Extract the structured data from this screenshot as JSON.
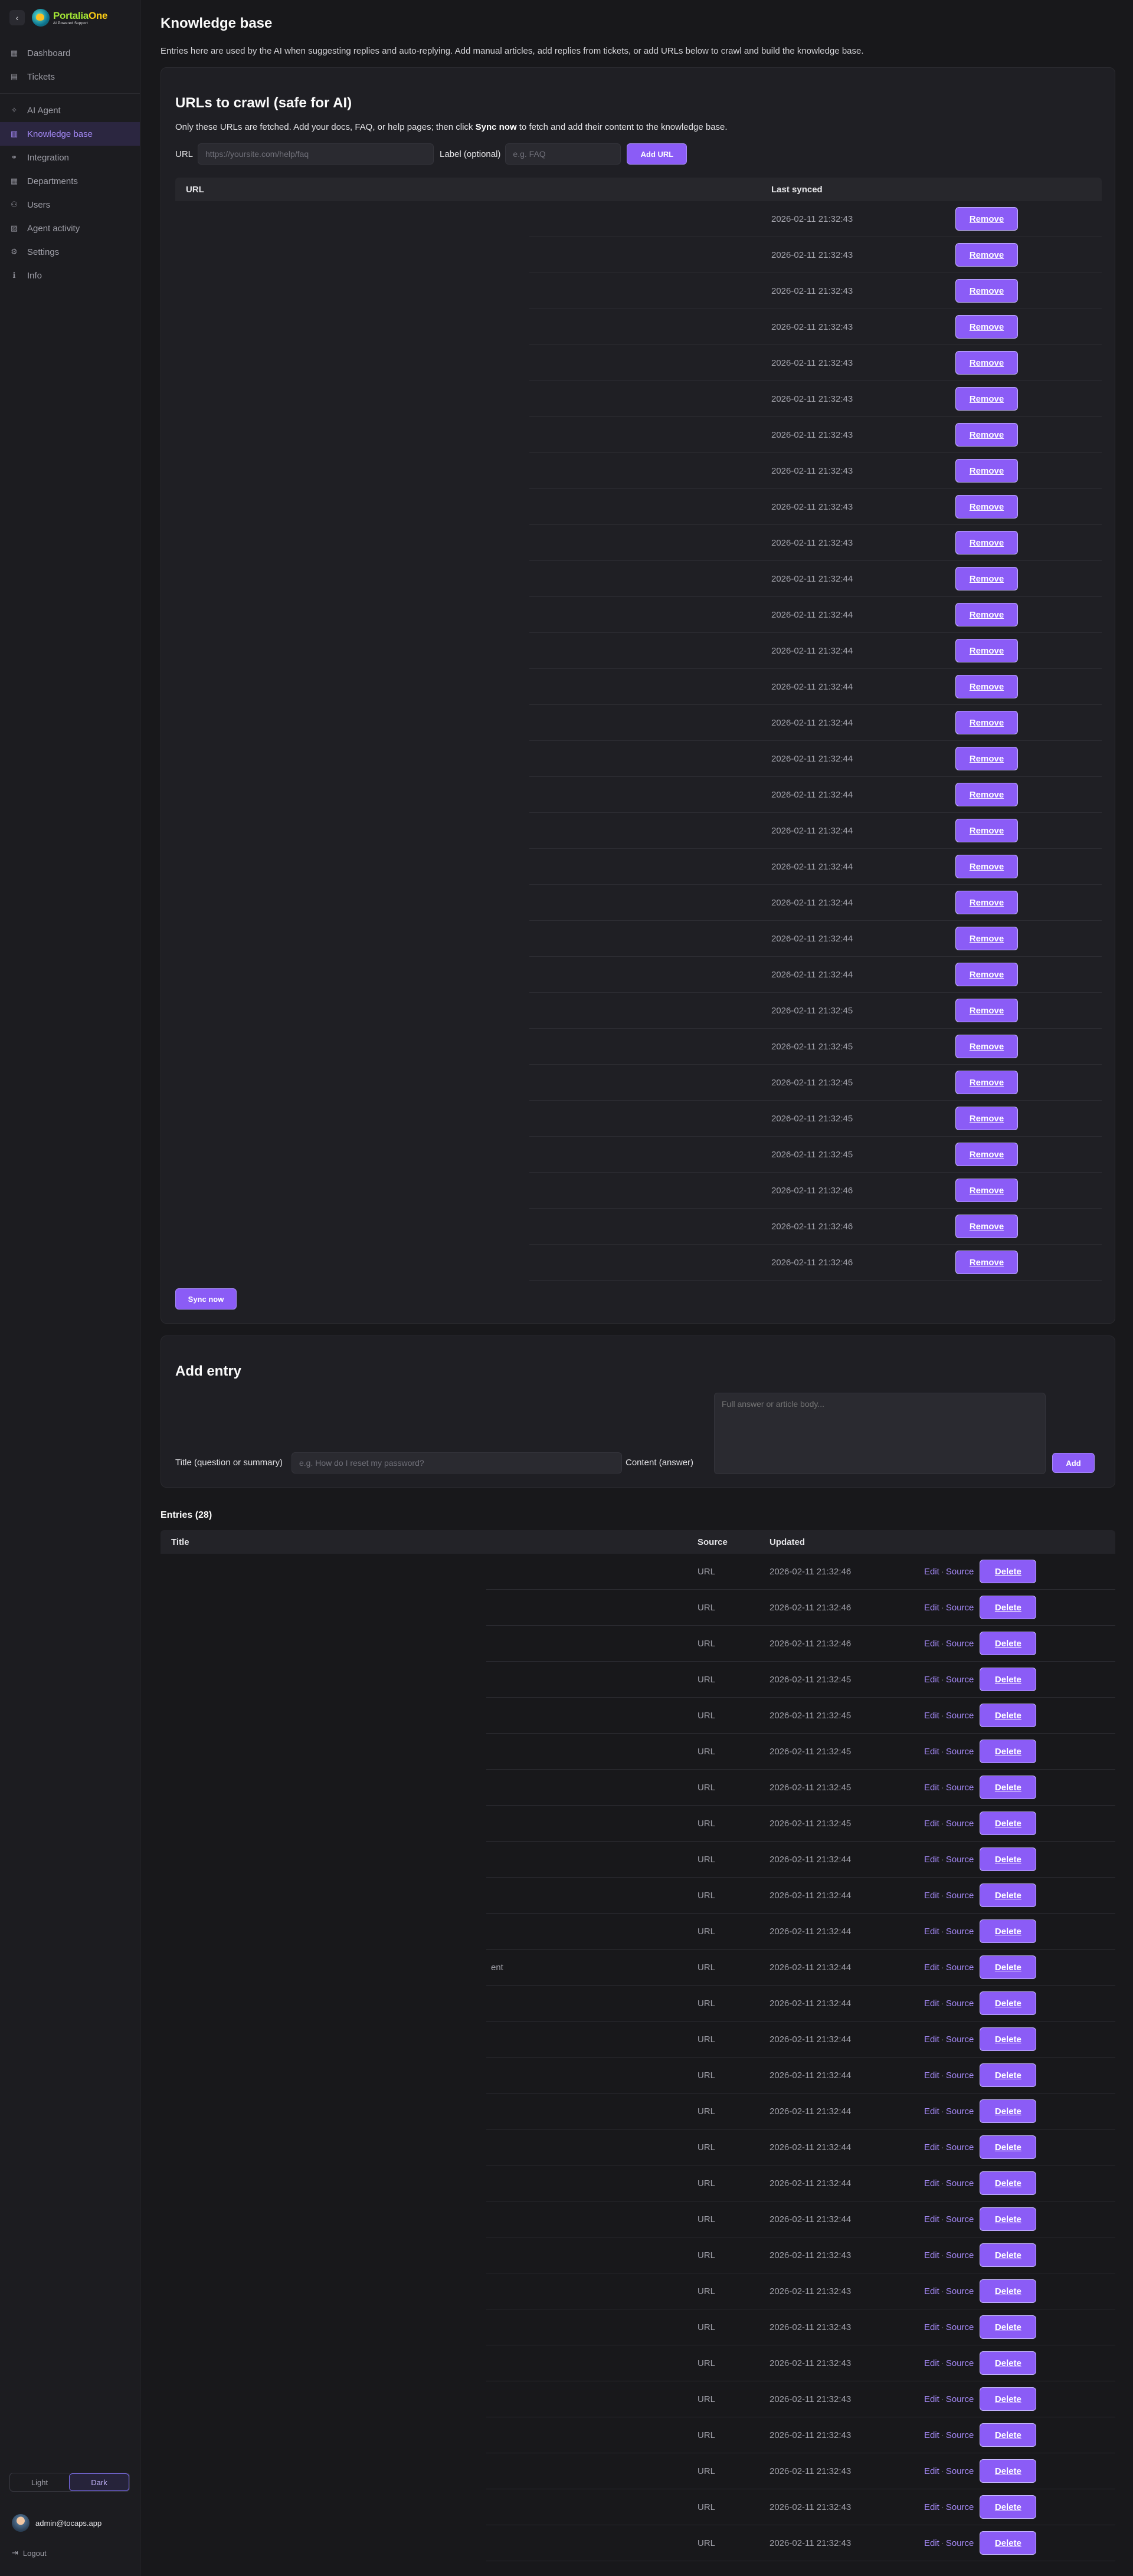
{
  "brand": {
    "name_a": "Portalia",
    "name_b": "One",
    "tagline": "AI Powered Support"
  },
  "sidebar": {
    "items": [
      {
        "label": "Dashboard",
        "icon": "grid-icon"
      },
      {
        "label": "Tickets",
        "icon": "ticket-icon"
      },
      {
        "label": "AI Agent",
        "icon": "sparkle-icon"
      },
      {
        "label": "Knowledge base",
        "icon": "book-icon",
        "active": true
      },
      {
        "label": "Integration",
        "icon": "link-icon"
      },
      {
        "label": "Departments",
        "icon": "building-icon"
      },
      {
        "label": "Users",
        "icon": "users-icon"
      },
      {
        "label": "Agent activity",
        "icon": "chart-icon"
      },
      {
        "label": "Settings",
        "icon": "gear-icon"
      },
      {
        "label": "Info",
        "icon": "info-icon"
      }
    ],
    "theme": {
      "light": "Light",
      "dark": "Dark",
      "selected": "dark"
    },
    "user_email": "admin@tocaps.app",
    "logout_label": "Logout"
  },
  "page": {
    "title": "Knowledge base",
    "description": "Entries here are used by the AI when suggesting replies and auto-replying. Add manual articles, add replies from tickets, or add URLs below to crawl and build the knowledge base."
  },
  "crawl": {
    "title": "URLs to crawl (safe for AI)",
    "hint_pre": "Only these URLs are fetched. Add your docs, FAQ, or help pages; then click ",
    "hint_bold": "Sync now",
    "hint_post": " to fetch and add their content to the knowledge base.",
    "url_label": "URL",
    "url_placeholder": "https://yoursite.com/help/faq",
    "label_label": "Label (optional)",
    "label_placeholder": "e.g. FAQ",
    "add_button": "Add URL",
    "col_url": "URL",
    "col_last_synced": "Last synced",
    "remove_label": "Remove",
    "sync_button": "Sync now",
    "rows": [
      {
        "url": "",
        "synced": "2026-02-11 21:32:43"
      },
      {
        "url": "",
        "synced": "2026-02-11 21:32:43"
      },
      {
        "url": "",
        "synced": "2026-02-11 21:32:43"
      },
      {
        "url": "",
        "synced": "2026-02-11 21:32:43"
      },
      {
        "url": "",
        "synced": "2026-02-11 21:32:43"
      },
      {
        "url": "",
        "synced": "2026-02-11 21:32:43"
      },
      {
        "url": "",
        "synced": "2026-02-11 21:32:43"
      },
      {
        "url": "",
        "synced": "2026-02-11 21:32:43"
      },
      {
        "url": "",
        "synced": "2026-02-11 21:32:43"
      },
      {
        "url": "",
        "synced": "2026-02-11 21:32:43"
      },
      {
        "url": "",
        "synced": "2026-02-11 21:32:44"
      },
      {
        "url": "",
        "synced": "2026-02-11 21:32:44"
      },
      {
        "url": "",
        "synced": "2026-02-11 21:32:44"
      },
      {
        "url": "",
        "synced": "2026-02-11 21:32:44"
      },
      {
        "url": "",
        "synced": "2026-02-11 21:32:44"
      },
      {
        "url": "",
        "synced": "2026-02-11 21:32:44"
      },
      {
        "url": "",
        "synced": "2026-02-11 21:32:44"
      },
      {
        "url": "",
        "synced": "2026-02-11 21:32:44"
      },
      {
        "url": "",
        "synced": "2026-02-11 21:32:44"
      },
      {
        "url": "",
        "synced": "2026-02-11 21:32:44"
      },
      {
        "url": "",
        "synced": "2026-02-11 21:32:44"
      },
      {
        "url": "",
        "synced": "2026-02-11 21:32:44"
      },
      {
        "url": "",
        "synced": "2026-02-11 21:32:45"
      },
      {
        "url": "",
        "synced": "2026-02-11 21:32:45"
      },
      {
        "url": "",
        "synced": "2026-02-11 21:32:45"
      },
      {
        "url": "",
        "synced": "2026-02-11 21:32:45"
      },
      {
        "url": "",
        "synced": "2026-02-11 21:32:45"
      },
      {
        "url": "",
        "synced": "2026-02-11 21:32:46"
      },
      {
        "url": "",
        "synced": "2026-02-11 21:32:46"
      },
      {
        "url": "",
        "synced": "2026-02-11 21:32:46"
      }
    ]
  },
  "add_entry": {
    "title": "Add entry",
    "title_label": "Title (question or summary)",
    "title_placeholder": "e.g. How do I reset my password?",
    "content_label": "Content (answer)",
    "content_placeholder": "Full answer or article body...",
    "add_button": "Add"
  },
  "entries": {
    "heading": "Entries (28)",
    "col_title": "Title",
    "col_source": "Source",
    "col_updated": "Updated",
    "edit_label": "Edit",
    "source_link": "Source",
    "separator": "·",
    "delete_label": "Delete",
    "rows": [
      {
        "title": "",
        "source": "URL",
        "updated": "2026-02-11 21:32:46"
      },
      {
        "title": "",
        "source": "URL",
        "updated": "2026-02-11 21:32:46"
      },
      {
        "title": "",
        "source": "URL",
        "updated": "2026-02-11 21:32:46"
      },
      {
        "title": "",
        "source": "URL",
        "updated": "2026-02-11 21:32:45"
      },
      {
        "title": "",
        "source": "URL",
        "updated": "2026-02-11 21:32:45"
      },
      {
        "title": "",
        "source": "URL",
        "updated": "2026-02-11 21:32:45"
      },
      {
        "title": "",
        "source": "URL",
        "updated": "2026-02-11 21:32:45"
      },
      {
        "title": "",
        "source": "URL",
        "updated": "2026-02-11 21:32:45"
      },
      {
        "title": "",
        "source": "URL",
        "updated": "2026-02-11 21:32:44"
      },
      {
        "title": "",
        "source": "URL",
        "updated": "2026-02-11 21:32:44"
      },
      {
        "title": "",
        "source": "URL",
        "updated": "2026-02-11 21:32:44"
      },
      {
        "title": "ent",
        "source": "URL",
        "updated": "2026-02-11 21:32:44"
      },
      {
        "title": "",
        "source": "URL",
        "updated": "2026-02-11 21:32:44"
      },
      {
        "title": "",
        "source": "URL",
        "updated": "2026-02-11 21:32:44"
      },
      {
        "title": "",
        "source": "URL",
        "updated": "2026-02-11 21:32:44"
      },
      {
        "title": "",
        "source": "URL",
        "updated": "2026-02-11 21:32:44"
      },
      {
        "title": "",
        "source": "URL",
        "updated": "2026-02-11 21:32:44"
      },
      {
        "title": "",
        "source": "URL",
        "updated": "2026-02-11 21:32:44"
      },
      {
        "title": "",
        "source": "URL",
        "updated": "2026-02-11 21:32:44"
      },
      {
        "title": "",
        "source": "URL",
        "updated": "2026-02-11 21:32:43"
      },
      {
        "title": "",
        "source": "URL",
        "updated": "2026-02-11 21:32:43"
      },
      {
        "title": "",
        "source": "URL",
        "updated": "2026-02-11 21:32:43"
      },
      {
        "title": "",
        "source": "URL",
        "updated": "2026-02-11 21:32:43"
      },
      {
        "title": "",
        "source": "URL",
        "updated": "2026-02-11 21:32:43"
      },
      {
        "title": "",
        "source": "URL",
        "updated": "2026-02-11 21:32:43"
      },
      {
        "title": "",
        "source": "URL",
        "updated": "2026-02-11 21:32:43"
      },
      {
        "title": "",
        "source": "URL",
        "updated": "2026-02-11 21:32:43"
      },
      {
        "title": "",
        "source": "URL",
        "updated": "2026-02-11 21:32:43"
      }
    ]
  },
  "colors": {
    "accent": "#8b5cf6",
    "accent_text": "#a78bfa",
    "background": "#18181b",
    "card": "#1f1f24"
  }
}
